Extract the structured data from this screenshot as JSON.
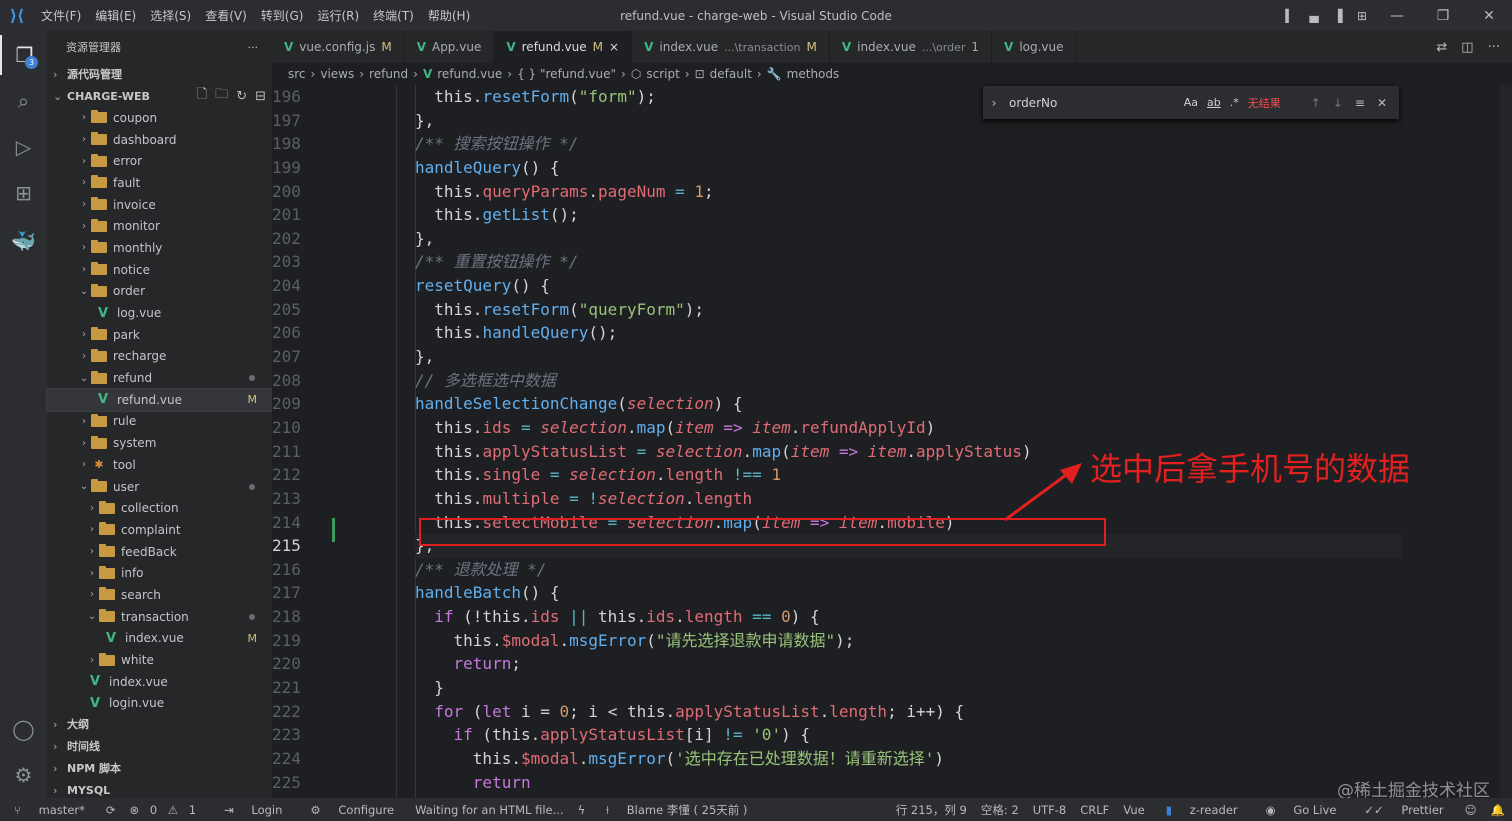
{
  "window": {
    "title": "refund.vue - charge-web - Visual Studio Code",
    "menu": [
      "文件(F)",
      "编辑(E)",
      "选择(S)",
      "查看(V)",
      "转到(G)",
      "运行(R)",
      "终端(T)",
      "帮助(H)"
    ]
  },
  "activity": {
    "explorer_badge": "3"
  },
  "sidebar": {
    "title": "资源管理器",
    "more": "···",
    "sections": {
      "scm": "源代码管理",
      "workspace": "CHARGE-WEB",
      "outline": "大纲",
      "timeline": "时间线",
      "npm": "NPM 脚本",
      "mysql": "MYSQL"
    },
    "tree": [
      {
        "label": "coupon",
        "type": "folder",
        "open": false,
        "depth": 0
      },
      {
        "label": "dashboard",
        "type": "folder",
        "open": false,
        "depth": 0
      },
      {
        "label": "error",
        "type": "folder",
        "open": false,
        "depth": 0
      },
      {
        "label": "fault",
        "type": "folder",
        "open": false,
        "depth": 0
      },
      {
        "label": "invoice",
        "type": "folder",
        "open": false,
        "depth": 0
      },
      {
        "label": "monitor",
        "type": "folder",
        "open": false,
        "depth": 0
      },
      {
        "label": "monthly",
        "type": "folder",
        "open": false,
        "depth": 0
      },
      {
        "label": "notice",
        "type": "folder",
        "open": false,
        "depth": 0
      },
      {
        "label": "order",
        "type": "folder",
        "open": true,
        "depth": 0
      },
      {
        "label": "log.vue",
        "type": "vue",
        "depth": 1
      },
      {
        "label": "park",
        "type": "folder",
        "open": false,
        "depth": 0
      },
      {
        "label": "recharge",
        "type": "folder",
        "open": false,
        "depth": 0
      },
      {
        "label": "refund",
        "type": "folder",
        "open": true,
        "depth": 0,
        "dot": true
      },
      {
        "label": "refund.vue",
        "type": "vue",
        "depth": 1,
        "status": "M",
        "selected": true
      },
      {
        "label": "rule",
        "type": "folder",
        "open": false,
        "depth": 0
      },
      {
        "label": "system",
        "type": "folder",
        "open": false,
        "depth": 0
      },
      {
        "label": "tool",
        "type": "tool",
        "open": false,
        "depth": 0
      },
      {
        "label": "user",
        "type": "folder",
        "open": true,
        "depth": 0,
        "dot": true
      },
      {
        "label": "collection",
        "type": "folder",
        "open": false,
        "depth": 1
      },
      {
        "label": "complaint",
        "type": "folder",
        "open": false,
        "depth": 1
      },
      {
        "label": "feedBack",
        "type": "folder",
        "open": false,
        "depth": 1
      },
      {
        "label": "info",
        "type": "folder",
        "open": false,
        "depth": 1
      },
      {
        "label": "search",
        "type": "folder",
        "open": false,
        "depth": 1
      },
      {
        "label": "transaction",
        "type": "folder",
        "open": true,
        "depth": 1,
        "dot": true
      },
      {
        "label": "index.vue",
        "type": "vue",
        "depth": 2,
        "status": "M"
      },
      {
        "label": "white",
        "type": "folder",
        "open": false,
        "depth": 1
      },
      {
        "label": "index.vue",
        "type": "vue",
        "depth": 0
      },
      {
        "label": "login.vue",
        "type": "vue",
        "depth": 0
      }
    ]
  },
  "tabs": [
    {
      "label": "vue.config.js",
      "status": "M",
      "active": false
    },
    {
      "label": "App.vue",
      "status": "",
      "active": false
    },
    {
      "label": "refund.vue",
      "status": "M",
      "close": "×",
      "active": true
    },
    {
      "label": "index.vue",
      "desc": "...\\transaction",
      "status": "M",
      "active": false
    },
    {
      "label": "index.vue",
      "desc": "...\\order",
      "status": "1",
      "active": false
    },
    {
      "label": "log.vue",
      "status": "",
      "active": false
    }
  ],
  "breadcrumb": [
    "src",
    "views",
    "refund",
    "refund.vue",
    "{ } \"refund.vue\"",
    "script",
    "default",
    "methods"
  ],
  "find": {
    "value": "orderNo",
    "result": "无结果",
    "opt_case": "Aa",
    "opt_word": "ab",
    "opt_regex": ".*"
  },
  "code": {
    "first_line": 196,
    "current_line": 215,
    "lines": [
      [
        [
          "  this.",
          ""
        ],
        [
          "resetForm",
          "fn"
        ],
        [
          "(",
          ""
        ],
        [
          "\"form\"",
          "str"
        ],
        [
          ");",
          ""
        ]
      ],
      [
        [
          "},",
          ""
        ]
      ],
      [
        [
          "/** 搜索按钮操作 */",
          "cm"
        ]
      ],
      [
        [
          "handleQuery",
          "fn"
        ],
        [
          "() {",
          ""
        ]
      ],
      [
        [
          "  this.",
          ""
        ],
        [
          "queryParams",
          "prop"
        ],
        [
          ".",
          ""
        ],
        [
          "pageNum",
          "prop"
        ],
        [
          " = ",
          "op"
        ],
        [
          "1",
          "num"
        ],
        [
          ";",
          ""
        ]
      ],
      [
        [
          "  this.",
          ""
        ],
        [
          "getList",
          "fn"
        ],
        [
          "();",
          ""
        ]
      ],
      [
        [
          "},",
          ""
        ]
      ],
      [
        [
          "/** 重置按钮操作 */",
          "cm"
        ]
      ],
      [
        [
          "resetQuery",
          "fn"
        ],
        [
          "() {",
          ""
        ]
      ],
      [
        [
          "  this.",
          ""
        ],
        [
          "resetForm",
          "fn"
        ],
        [
          "(",
          ""
        ],
        [
          "\"queryForm\"",
          "str"
        ],
        [
          ");",
          ""
        ]
      ],
      [
        [
          "  this.",
          ""
        ],
        [
          "handleQuery",
          "fn"
        ],
        [
          "();",
          ""
        ]
      ],
      [
        [
          "},",
          ""
        ]
      ],
      [
        [
          "// 多选框选中数据",
          "cm"
        ]
      ],
      [
        [
          "handleSelectionChange",
          "fn"
        ],
        [
          "(",
          ""
        ],
        [
          "selection",
          "it"
        ],
        [
          ") {",
          ""
        ]
      ],
      [
        [
          "  this.",
          ""
        ],
        [
          "ids",
          "prop"
        ],
        [
          " = ",
          "op"
        ],
        [
          "selection",
          "it"
        ],
        [
          ".",
          ""
        ],
        [
          "map",
          "fn"
        ],
        [
          "(",
          ""
        ],
        [
          "item",
          "it"
        ],
        [
          " => ",
          "kw"
        ],
        [
          "item",
          "it"
        ],
        [
          ".",
          ""
        ],
        [
          "refundApplyId",
          "prop"
        ],
        [
          ")",
          ""
        ]
      ],
      [
        [
          "  this.",
          ""
        ],
        [
          "applyStatusList",
          "prop"
        ],
        [
          " = ",
          "op"
        ],
        [
          "selection",
          "it"
        ],
        [
          ".",
          ""
        ],
        [
          "map",
          "fn"
        ],
        [
          "(",
          ""
        ],
        [
          "item",
          "it"
        ],
        [
          " => ",
          "kw"
        ],
        [
          "item",
          "it"
        ],
        [
          ".",
          ""
        ],
        [
          "applyStatus",
          "prop"
        ],
        [
          ")",
          ""
        ]
      ],
      [
        [
          "  this.",
          ""
        ],
        [
          "single",
          "prop"
        ],
        [
          " = ",
          "op"
        ],
        [
          "selection",
          "it"
        ],
        [
          ".",
          ""
        ],
        [
          "length",
          "prop"
        ],
        [
          " !== ",
          "op"
        ],
        [
          "1",
          "num"
        ]
      ],
      [
        [
          "  this.",
          ""
        ],
        [
          "multiple",
          "prop"
        ],
        [
          " = !",
          "op"
        ],
        [
          "selection",
          "it"
        ],
        [
          ".",
          ""
        ],
        [
          "length",
          "prop"
        ]
      ],
      [
        [
          "  this.",
          ""
        ],
        [
          "selectMobile",
          "prop"
        ],
        [
          " = ",
          "op"
        ],
        [
          "selection",
          "it"
        ],
        [
          ".",
          ""
        ],
        [
          "map",
          "fn"
        ],
        [
          "(",
          ""
        ],
        [
          "item",
          "it"
        ],
        [
          " => ",
          "kw"
        ],
        [
          "item",
          "it"
        ],
        [
          ".",
          ""
        ],
        [
          "mobile",
          "prop"
        ],
        [
          ")",
          ""
        ]
      ],
      [
        [
          "},",
          ""
        ]
      ],
      [
        [
          "/** 退款处理 */",
          "cm"
        ]
      ],
      [
        [
          "handleBatch",
          "fn"
        ],
        [
          "() {",
          ""
        ]
      ],
      [
        [
          "  ",
          ""
        ],
        [
          "if",
          "kw"
        ],
        [
          " (!this.",
          ""
        ],
        [
          "ids",
          "prop"
        ],
        [
          " || ",
          "op"
        ],
        [
          "this.",
          ""
        ],
        [
          "ids",
          "prop"
        ],
        [
          ".",
          ""
        ],
        [
          "length",
          "prop"
        ],
        [
          " == ",
          "op"
        ],
        [
          "0",
          "num"
        ],
        [
          ") {",
          ""
        ]
      ],
      [
        [
          "    this.",
          ""
        ],
        [
          "$modal",
          "prop"
        ],
        [
          ".",
          ""
        ],
        [
          "msgError",
          "fn"
        ],
        [
          "(",
          ""
        ],
        [
          "\"请先选择退款申请数据\"",
          "str"
        ],
        [
          ");",
          ""
        ]
      ],
      [
        [
          "    ",
          ""
        ],
        [
          "return",
          "kw"
        ],
        [
          ";",
          ""
        ]
      ],
      [
        [
          "  }",
          ""
        ]
      ],
      [
        [
          "  ",
          ""
        ],
        [
          "for",
          "kw"
        ],
        [
          " (",
          ""
        ],
        [
          "let",
          "kw"
        ],
        [
          " i = ",
          ""
        ],
        [
          "0",
          "num"
        ],
        [
          "; i < this.",
          ""
        ],
        [
          "applyStatusList",
          "prop"
        ],
        [
          ".",
          ""
        ],
        [
          "length",
          "prop"
        ],
        [
          "; i++) {",
          ""
        ]
      ],
      [
        [
          "    ",
          ""
        ],
        [
          "if",
          "kw"
        ],
        [
          " (this.",
          ""
        ],
        [
          "applyStatusList",
          "prop"
        ],
        [
          "[i] ",
          ""
        ],
        [
          "!=",
          "op"
        ],
        [
          " ",
          ""
        ],
        [
          "'0'",
          "str"
        ],
        [
          ") {",
          ""
        ]
      ],
      [
        [
          "      this.",
          ""
        ],
        [
          "$modal",
          "prop"
        ],
        [
          ".",
          ""
        ],
        [
          "msgError",
          "fn"
        ],
        [
          "(",
          ""
        ],
        [
          "'选中存在已处理数据！请重新选择'",
          "str"
        ],
        [
          ")",
          ""
        ]
      ],
      [
        [
          "      ",
          ""
        ],
        [
          "return",
          "kw"
        ]
      ]
    ]
  },
  "annotation": {
    "text": "选中后拿手机号的数据",
    "color": "#e22020"
  },
  "status": {
    "branch": "master*",
    "errors": "0",
    "warnings": "1",
    "login": "Login",
    "configure": "Configure",
    "waiting": "Waiting for an HTML file...",
    "blame": "Blame 李懂 ( 25天前 )",
    "position": "行 215，列 9",
    "spaces": "空格: 2",
    "encoding": "UTF-8",
    "eol": "CRLF",
    "language": "Vue",
    "reader": "z-reader",
    "golive": "Go Live",
    "prettier": "Prettier"
  },
  "watermark": "@稀土掘金技术社区"
}
